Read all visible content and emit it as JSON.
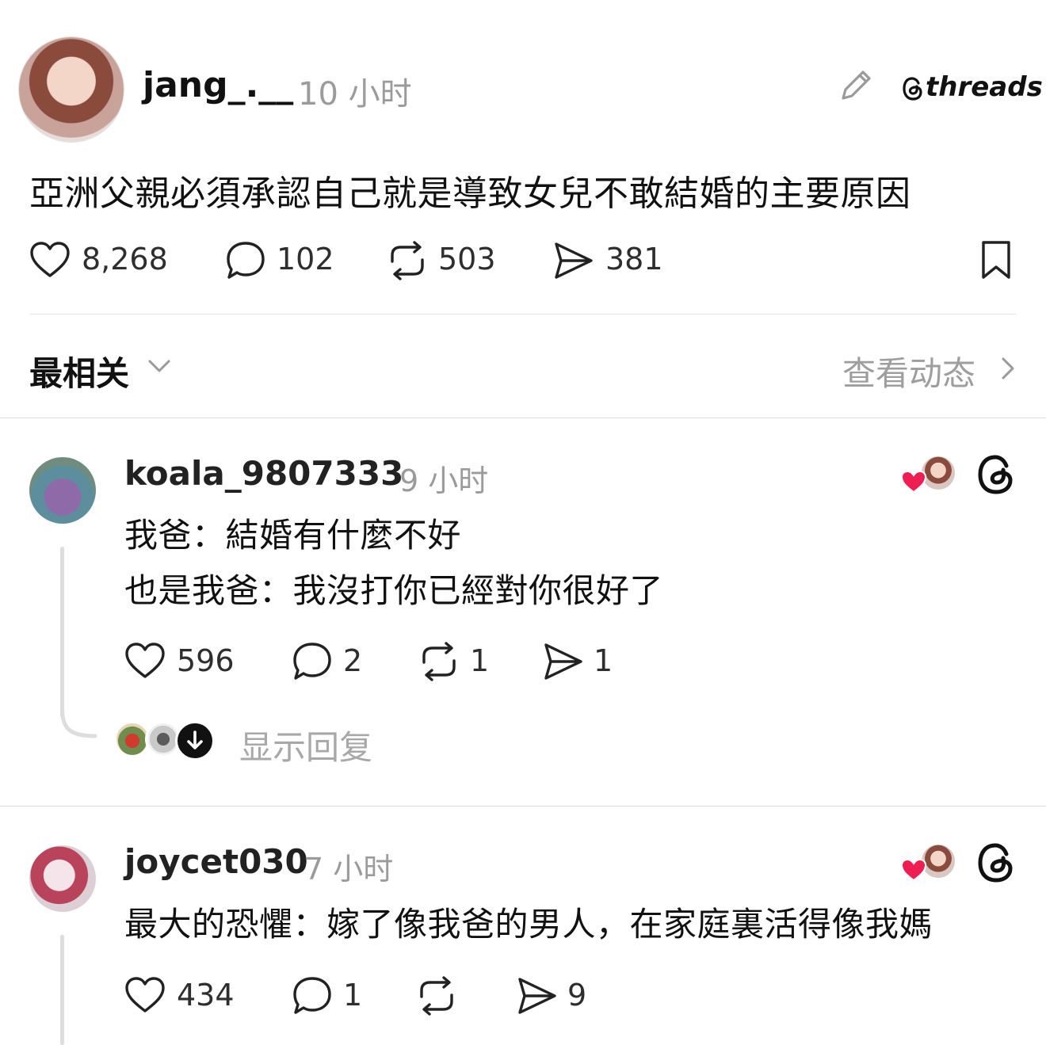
{
  "post": {
    "username": "jang_.__",
    "time": "10 小时",
    "text": "亞洲父親必須承認自己就是導致女兒不敢結婚的主要原因",
    "likes": "8,268",
    "replies": "102",
    "reposts": "503",
    "shares": "381",
    "brand": "threads"
  },
  "sort": {
    "label": "最相关",
    "activity_label": "查看动态"
  },
  "comments": [
    {
      "username": "koala_9807333",
      "time": "9 小时",
      "lines": [
        "我爸：結婚有什麼不好",
        "也是我爸：我沒打你已經對你很好了"
      ],
      "likes": "596",
      "replies": "2",
      "reposts": "1",
      "shares": "1",
      "show_replies": "显示回复"
    },
    {
      "username": "joycet030",
      "time": "7 小时",
      "lines": [
        "最大的恐懼：嫁了像我爸的男人，在家庭裏活得像我媽"
      ],
      "likes": "434",
      "replies": "1",
      "reposts": "",
      "shares": "9"
    }
  ],
  "colors": {
    "heart_red": "#ee1d52",
    "muted": "#9b9b9b",
    "divider": "#e3e3e3"
  }
}
